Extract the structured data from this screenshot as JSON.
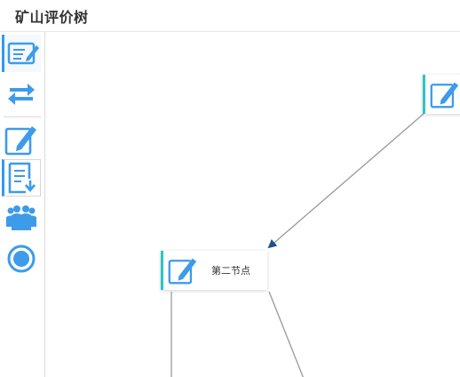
{
  "app": {
    "title": "矿山评价树"
  },
  "toolbar": {
    "items": [
      {
        "icon": "edit-card-icon",
        "state": "active"
      },
      {
        "icon": "transfer-arrows-icon",
        "state": "normal"
      },
      {
        "icon": "edit-pencil-icon",
        "state": "normal"
      },
      {
        "icon": "document-download-icon",
        "state": "bordered"
      },
      {
        "icon": "team-users-icon",
        "state": "normal"
      },
      {
        "icon": "record-circle-icon",
        "state": "normal"
      }
    ]
  },
  "tree": {
    "nodes": [
      {
        "id": "root",
        "label": ""
      },
      {
        "id": "n2",
        "label": "第二节点"
      }
    ]
  },
  "colors": {
    "accent": "#3399ee",
    "node_edge": "#2ec4c4",
    "icon_blue": "#3d9be9",
    "link": "#999999",
    "arrow": "#1f4f8f"
  }
}
